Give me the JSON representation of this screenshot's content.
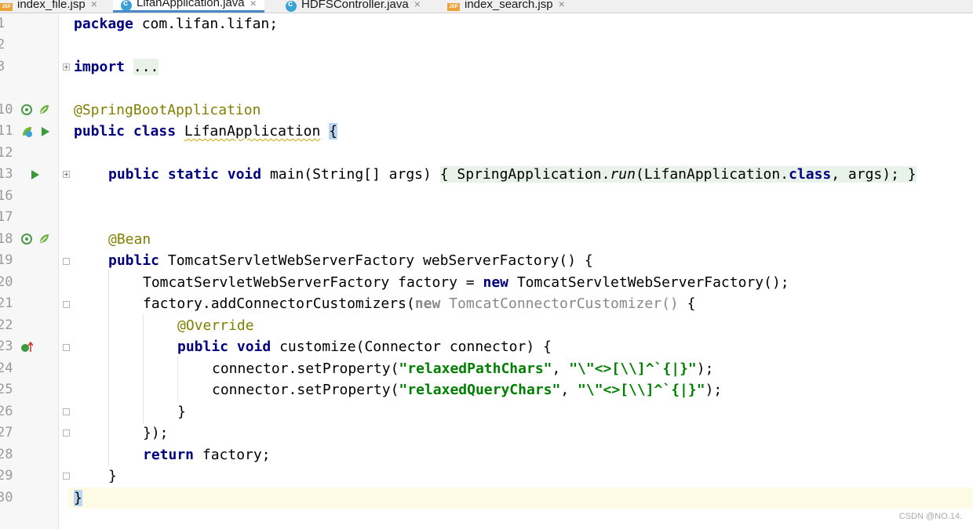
{
  "tabs": [
    {
      "label": "index_file.jsp",
      "icon": "jsp-file-icon",
      "active": false
    },
    {
      "label": "LifanApplication.java",
      "icon": "java-class-icon",
      "active": true
    },
    {
      "label": "HDFSController.java",
      "icon": "java-class-icon",
      "active": false
    },
    {
      "label": "index_search.jsp",
      "icon": "jsp-file-icon",
      "active": false
    }
  ],
  "editor": {
    "line_numbers": [
      "1",
      "2",
      "3",
      "10",
      "11",
      "12",
      "13",
      "16",
      "17",
      "18",
      "19",
      "20",
      "21",
      "22",
      "23",
      "24",
      "25",
      "26",
      "27",
      "28",
      "29",
      "30"
    ],
    "tokens": {
      "package_kw": "package",
      "package_name": " com.lifan.lifan;",
      "import_kw": "import",
      "import_fold": "...",
      "ann_sba": "@SpringBootApplication",
      "public": "public",
      "class": "class",
      "class_name": "LifanApplication",
      "brace_open": "{",
      "static": "static",
      "void": "void",
      "main_sig": "main(String[] args)",
      "main_body_a": "SpringApplication.",
      "main_run": "run",
      "main_body_b": "(LifanApplication.",
      "class_kw": "class",
      "main_body_c": ", args);",
      "brace_close": "}",
      "ann_bean": "@Bean",
      "factory_type": "TomcatServletWebServerFactory",
      "method_ws": "webServerFactory() {",
      "factory_decl": "TomcatServletWebServerFactory factory = ",
      "new_kw": "new",
      "factory_ctor": "TomcatServletWebServerFactory();",
      "add_cust": "factory.addConnectorCustomizers(",
      "anon_type": "TomcatConnectorCustomizer()",
      "ann_override": "@Override",
      "customize_sig": "customize(Connector connector) {",
      "set_prop": "connector.setProperty(",
      "str_path": "\"relaxedPathChars\"",
      "str_query": "\"relaxedQueryChars\"",
      "comma": ", ",
      "str_chars": "\"\\\"<>[\\\\]^`{|}\"",
      "close_paren": ");",
      "close_anon": "});",
      "return_kw": "return",
      "return_val": " factory;"
    }
  },
  "watermark": "CSDN @NO.14."
}
